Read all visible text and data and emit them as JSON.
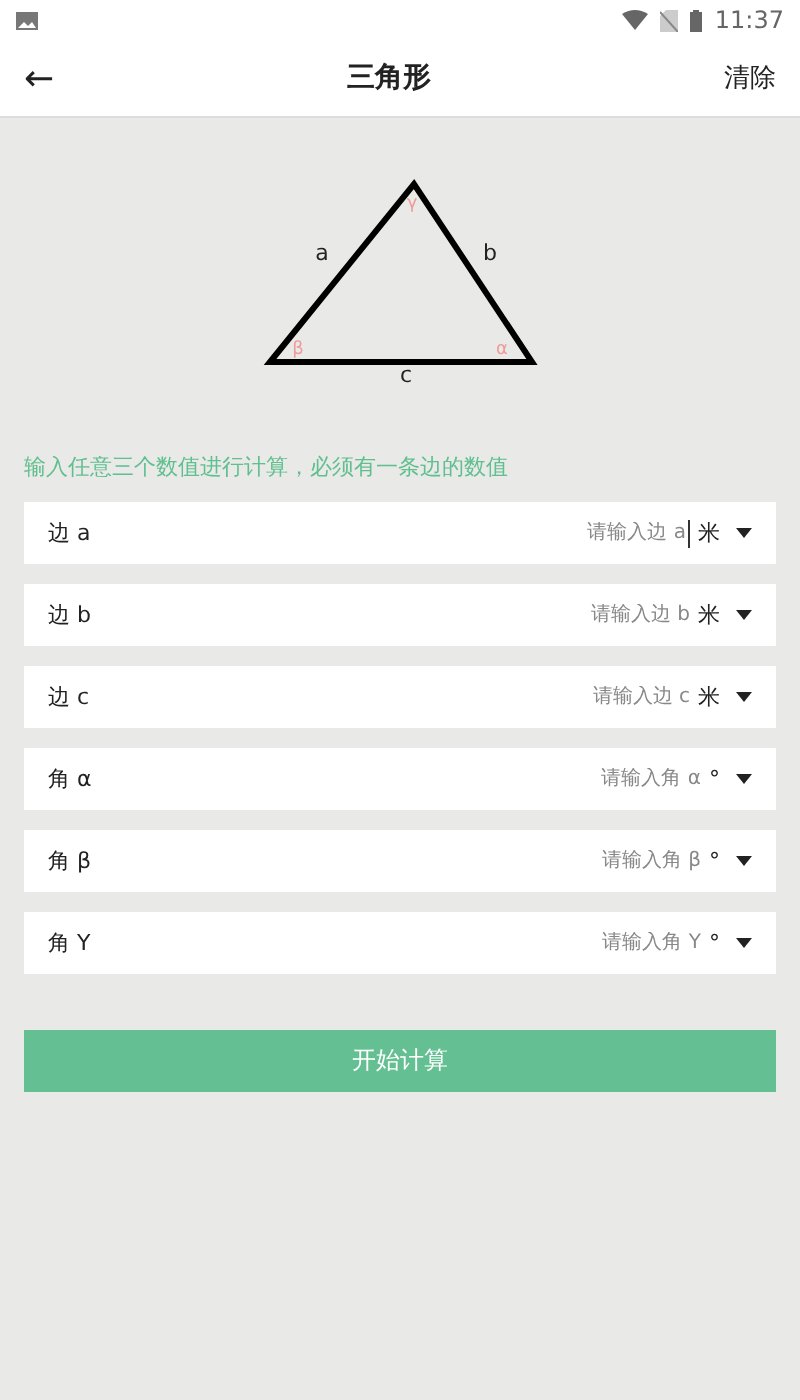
{
  "status_bar": {
    "time": "11:37"
  },
  "header": {
    "back": "←",
    "title": "三角形",
    "action": "清除"
  },
  "diagram": {
    "side_labels": [
      "a",
      "b",
      "c"
    ],
    "angle_labels": [
      "γ",
      "β",
      "α"
    ]
  },
  "hint": "输入任意三个数值进行计算，必须有一条边的数值",
  "fields": [
    {
      "label": "边 a",
      "placeholder": "请输入边 a",
      "unit": "米",
      "focused": true
    },
    {
      "label": "边 b",
      "placeholder": "请输入边 b",
      "unit": "米",
      "focused": false
    },
    {
      "label": "边 c",
      "placeholder": "请输入边 c",
      "unit": "米",
      "focused": false
    },
    {
      "label": "角 α",
      "placeholder": "请输入角 α",
      "unit": "°",
      "focused": false
    },
    {
      "label": "角 β",
      "placeholder": "请输入角 β",
      "unit": "°",
      "focused": false
    },
    {
      "label": "角 Y",
      "placeholder": "请输入角 Y",
      "unit": "°",
      "focused": false
    }
  ],
  "button": "开始计算"
}
